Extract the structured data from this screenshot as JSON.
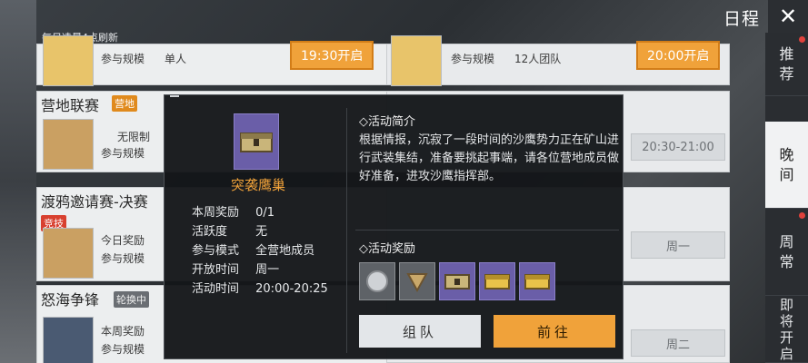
{
  "header": {
    "refresh_hint": "每日凌晨4点刷新",
    "title": "日程",
    "close_label": "✕"
  },
  "tabs": [
    {
      "label": "推\n荐",
      "dot": true
    },
    {
      "label": "晚\n间",
      "dot": false,
      "active": true
    },
    {
      "label": "周\n常",
      "dot": true
    },
    {
      "label": "即\n将\n开\n启",
      "dot": false
    }
  ],
  "list": {
    "card1": {
      "k1": "参与规模",
      "v1": "单人",
      "k0": "",
      "time_text": "19:30开启"
    },
    "card2": {
      "title": "营地联赛",
      "badge": "营地",
      "k1": "无限制",
      "k2": "参与规模"
    },
    "card3": {
      "title": "渡鸦邀请赛-决赛",
      "badge": "竞技",
      "k1": "今日奖励",
      "k2": "参与规模"
    },
    "card4": {
      "title": "怒海争锋",
      "badge": "轮换中",
      "k1": "本周奖励",
      "k2": "参与规模"
    }
  },
  "right_col": {
    "card1": {
      "k1": "参与规模",
      "v1": "12人团队",
      "time_text": "20:00开启"
    },
    "card2": {
      "time_text": "20:30-21:00"
    },
    "card3": {
      "time_text": "周一"
    },
    "card4": {
      "time_text": "周二"
    }
  },
  "modal": {
    "event_name": "突袭鹰巢",
    "info": [
      {
        "label": "本周奖励",
        "value": "0/1"
      },
      {
        "label": "活跃度",
        "value": "无"
      },
      {
        "label": "参与模式",
        "value": "全营地成员"
      },
      {
        "label": "开放时间",
        "value": "周一"
      },
      {
        "label": "活动时间",
        "value": "20:00-20:25"
      }
    ],
    "intro_title": "◇活动简介",
    "description": "根据情报，沉寂了一段时间的沙鹰势力正在矿山进行武装集结，准备要挑起事端，请各位营地成员做好准备，进攻沙鹰指挥部。",
    "reward_title": "◇活动奖励",
    "rewards": [
      "silver-coin-icon",
      "triangle-badge-icon",
      "crate-icon",
      "golden-chest-icon",
      "golden-chest-icon"
    ],
    "team_button": "组队",
    "go_button": "前往"
  }
}
